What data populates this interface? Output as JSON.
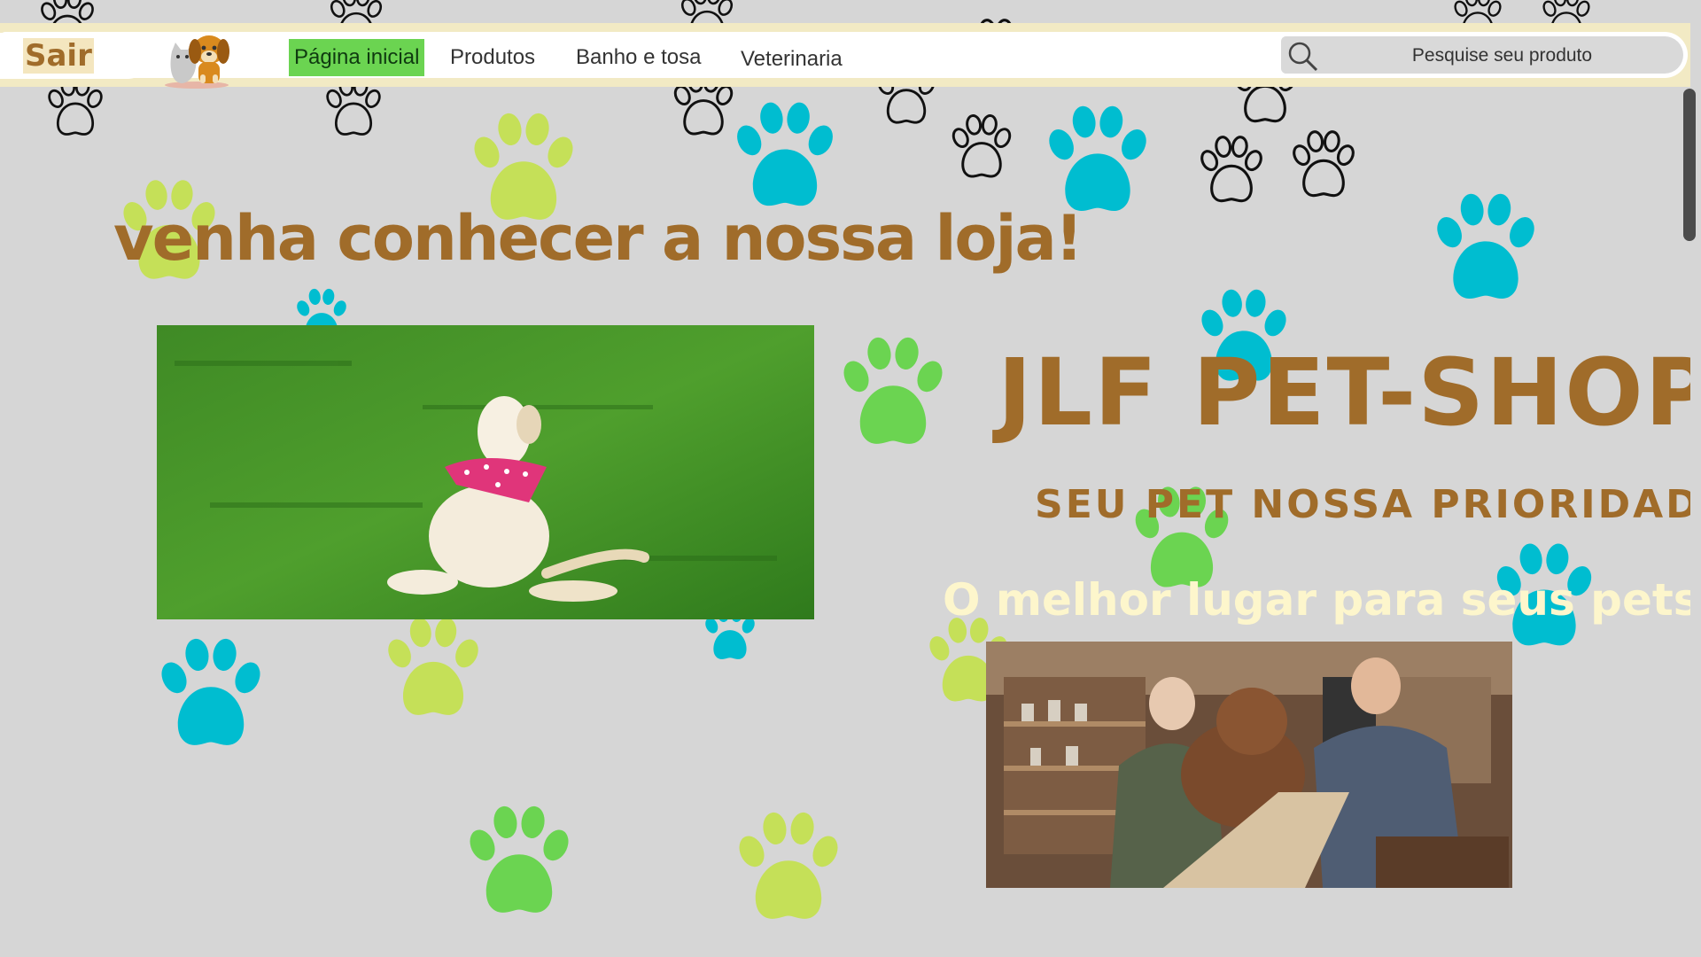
{
  "colors": {
    "background": "#d6d6d6",
    "brand_brown": "#a06c2a",
    "nav_active": "#6bd451",
    "paw_teal": "#00bdd0",
    "paw_green": "#6bd451",
    "paw_lime": "#c5e058",
    "cream": "#fdf6cc"
  },
  "header": {
    "logout_label": "Sair",
    "logo_icon": "dog-and-cat-logo",
    "nav": [
      {
        "label": "Página inicial",
        "active": true
      },
      {
        "label": "Produtos",
        "active": false
      },
      {
        "label": "Banho e tosa",
        "active": false
      },
      {
        "label": "Veterinaria",
        "active": false
      }
    ],
    "search": {
      "icon": "search-icon",
      "placeholder": "Pesquise seu produto"
    }
  },
  "main": {
    "headline": "venha conhecer a nossa loja!",
    "brand": "JLF PET-SHOP",
    "tagline": "SEU PET NOSSA PRIORIDADE",
    "subtagline": "O melhor lugar para seus pets !",
    "photo_left": "puppy-on-grass-photo",
    "photo_right": "people-with-dog-in-petshop-photo"
  }
}
